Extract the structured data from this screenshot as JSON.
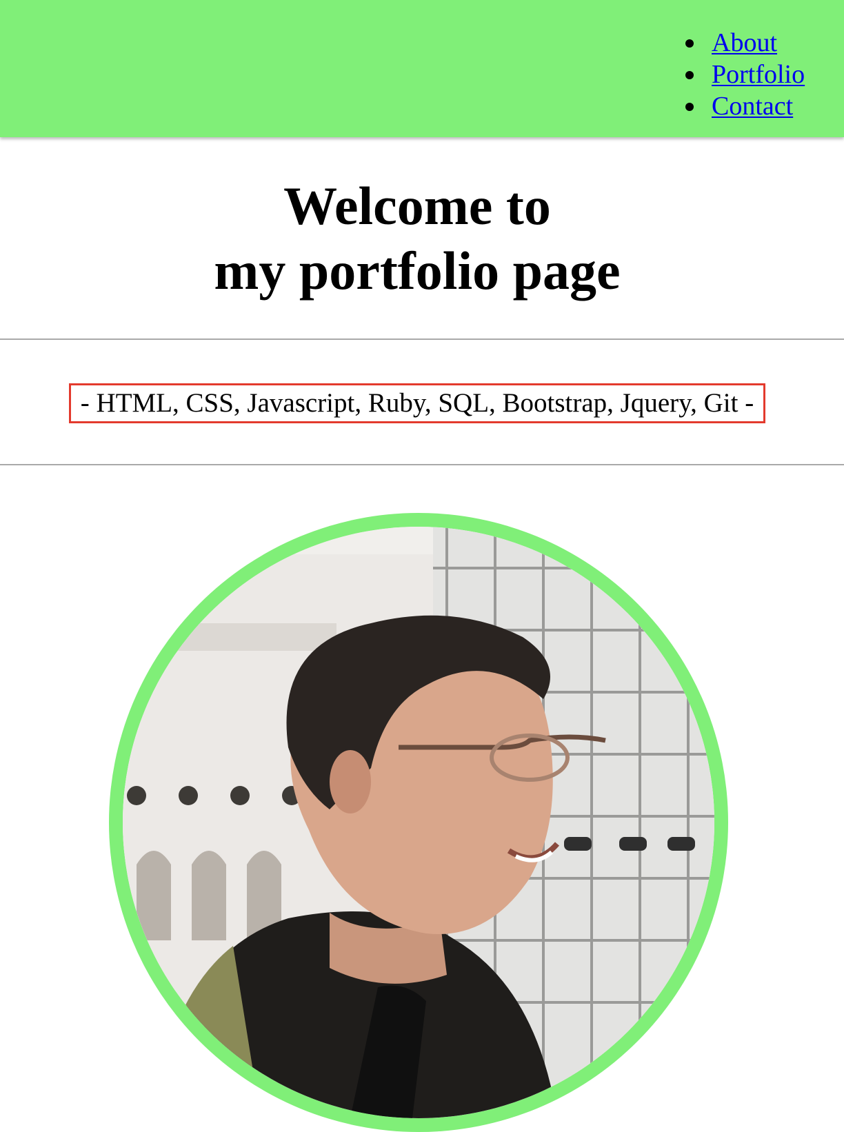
{
  "nav": {
    "items": [
      {
        "label": "About"
      },
      {
        "label": "Portfolio"
      },
      {
        "label": "Contact"
      }
    ]
  },
  "hero": {
    "title_line1": "Welcome to",
    "title_line2": "my portfolio page"
  },
  "skills": {
    "text": "- HTML, CSS, Javascript, Ruby, SQL, Bootstrap, Jquery, Git -"
  },
  "colors": {
    "header_bg": "#80ef78",
    "link": "#0000ee",
    "highlight_border": "#e33a2d",
    "avatar_ring": "#80ef78"
  }
}
